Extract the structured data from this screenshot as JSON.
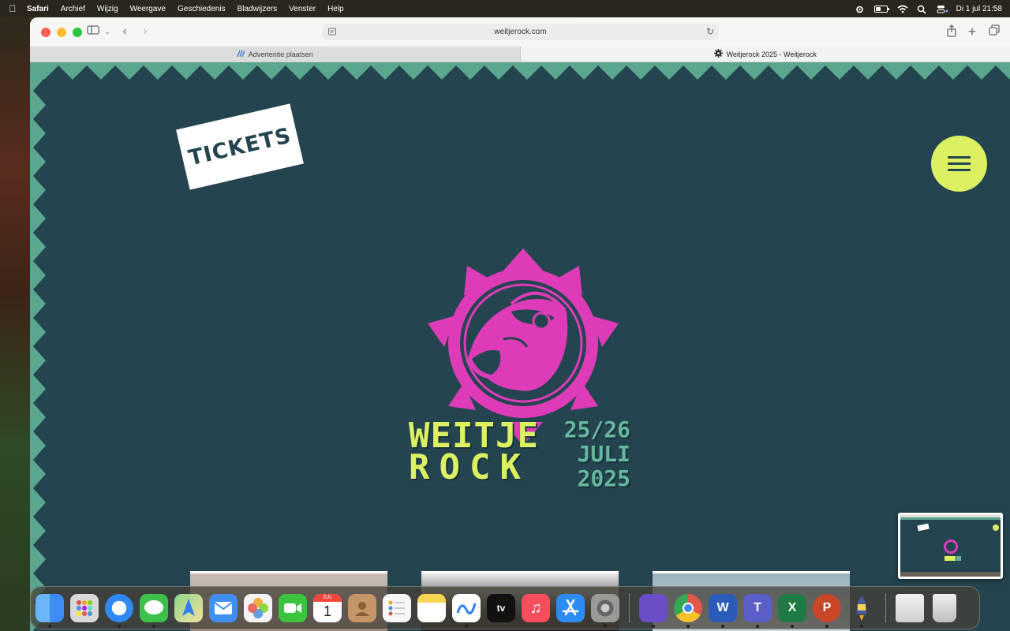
{
  "menubar": {
    "app_name": "Safari",
    "menus": [
      "Archief",
      "Wijzig",
      "Weergave",
      "Geschiedenis",
      "Bladwijzers",
      "Venster",
      "Help"
    ],
    "datetime": "Di 1 jul  21:58"
  },
  "browser": {
    "address": "weitjerock.com",
    "tabs": [
      {
        "label": "Advertentie plaatsen",
        "active": false
      },
      {
        "label": "Weitjerock 2025 - Weitjerock",
        "active": true
      }
    ]
  },
  "page": {
    "tickets_label": "TICKETS",
    "wordmark_line1": "WEITJE",
    "wordmark_line2": "ROCK",
    "date_line1": "25/26",
    "date_line2": "JULI",
    "date_line3": "2025",
    "colors": {
      "background": "#244550",
      "accent_lime": "#dcf062",
      "accent_pink": "#dd3bb8",
      "accent_green": "#66b79c",
      "zigzag": "#5aa68e"
    }
  },
  "thumbnail": {
    "tickets_label": "TICKETS",
    "wordmark": "WEITJE ROCK"
  },
  "dock": {
    "apps": [
      {
        "name": "finder",
        "color": "#3d8df5"
      },
      {
        "name": "launchpad",
        "color": "#d9d9d9"
      },
      {
        "name": "safari",
        "color": "#2e89f2"
      },
      {
        "name": "messages",
        "color": "#3ec14a"
      },
      {
        "name": "maps",
        "color": "#64c063"
      },
      {
        "name": "mail",
        "color": "#3f8ef0"
      },
      {
        "name": "photos",
        "color": "#f3f3f3"
      },
      {
        "name": "facetime",
        "color": "#3cc43e"
      },
      {
        "name": "calendar",
        "color": "#ffffff",
        "label": "1",
        "month": "JUL"
      },
      {
        "name": "contacts",
        "color": "#c49567"
      },
      {
        "name": "reminders",
        "color": "#f6f6f6"
      },
      {
        "name": "notes",
        "color": "#f7d54f"
      },
      {
        "name": "freeform",
        "color": "#ffffff"
      },
      {
        "name": "apple-tv",
        "color": "#111111",
        "label": "tv"
      },
      {
        "name": "music",
        "color": "#f84d5d"
      },
      {
        "name": "app-store",
        "color": "#2c8cf2"
      },
      {
        "name": "system-settings",
        "color": "#8c8c8c"
      }
    ],
    "apps_right": [
      {
        "name": "simulator",
        "color": "#6a4ec8"
      },
      {
        "name": "chrome",
        "color": "#f2f2f2"
      },
      {
        "name": "word",
        "color": "#2b5bb9"
      },
      {
        "name": "teams",
        "color": "#5b5fc7"
      },
      {
        "name": "excel",
        "color": "#1f7a45"
      },
      {
        "name": "powerpoint",
        "color": "#c94728"
      },
      {
        "name": "rocket-typist",
        "color": "#3a3a3a"
      }
    ],
    "apps_end": [
      {
        "name": "downloads-stack",
        "color": "#e8e8e8"
      },
      {
        "name": "trash",
        "color": "#dcdcdc"
      }
    ]
  }
}
